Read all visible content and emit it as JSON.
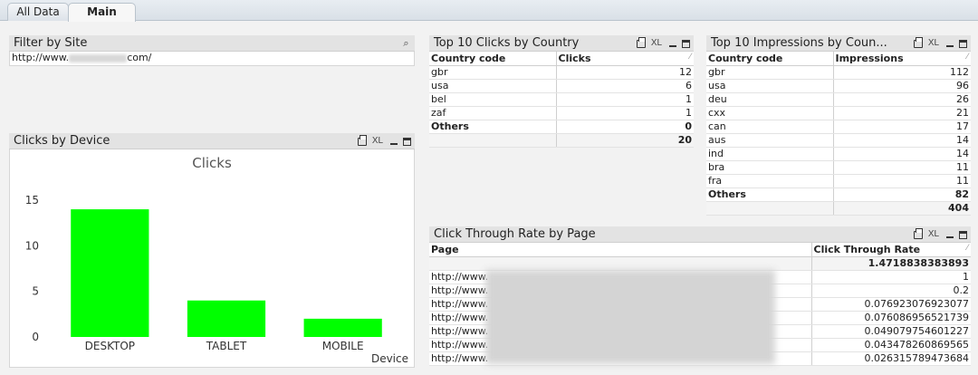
{
  "tabs": [
    {
      "label": "All Data"
    },
    {
      "label": "Main"
    }
  ],
  "filter": {
    "title": "Filter by Site",
    "value_prefix": "http://www.",
    "value_suffix": "com/"
  },
  "clicks_country": {
    "title": "Top 10 Clicks by Country",
    "xl": "XL",
    "headers": [
      "Country code",
      "Clicks"
    ],
    "rows": [
      [
        "gbr",
        "12"
      ],
      [
        "usa",
        "6"
      ],
      [
        "bel",
        "1"
      ],
      [
        "zaf",
        "1"
      ]
    ],
    "others": [
      "Others",
      "0"
    ],
    "total": "20"
  },
  "impr_country": {
    "title": "Top 10 Impressions by Coun...",
    "xl": "XL",
    "headers": [
      "Country code",
      "Impressions"
    ],
    "rows": [
      [
        "gbr",
        "112"
      ],
      [
        "usa",
        "96"
      ],
      [
        "deu",
        "26"
      ],
      [
        "cxx",
        "21"
      ],
      [
        "can",
        "17"
      ],
      [
        "aus",
        "14"
      ],
      [
        "ind",
        "14"
      ],
      [
        "bra",
        "11"
      ],
      [
        "fra",
        "11"
      ]
    ],
    "others": [
      "Others",
      "82"
    ],
    "total": "404"
  },
  "device": {
    "title": "Clicks by Device",
    "xl": "XL"
  },
  "chart_data": {
    "type": "bar",
    "title": "Clicks",
    "xlabel": "Device",
    "ylabel": "",
    "categories": [
      "DESKTOP",
      "TABLET",
      "MOBILE"
    ],
    "values": [
      14,
      4,
      2
    ],
    "ylim": [
      0,
      15
    ],
    "yticks": [
      0,
      5,
      10,
      15
    ],
    "color": "#00ff00",
    "grid": false
  },
  "ctr": {
    "title": "Click Through Rate by Page",
    "headers": [
      "Page",
      "Click Through Rate"
    ],
    "total": "1.4718838383893",
    "page_prefix": "http://www.",
    "values": [
      "1",
      "0.2",
      "0.076923076923077",
      "0.076086956521739",
      "0.049079754601227",
      "0.043478260869565",
      "0.026315789473684"
    ]
  }
}
